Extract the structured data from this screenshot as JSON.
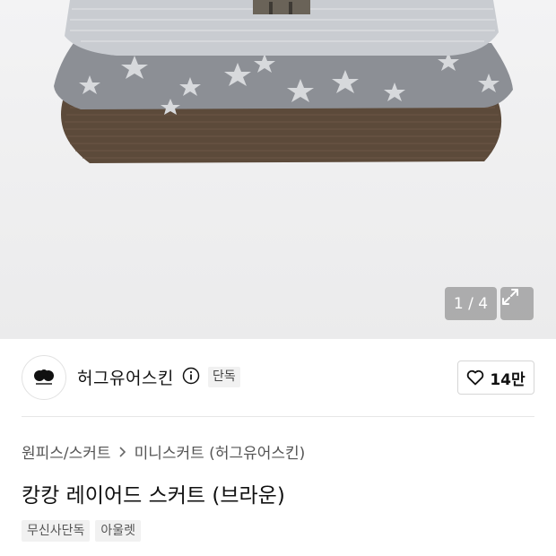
{
  "gallery": {
    "counter": "1 / 4",
    "expand_icon": "expand-icon"
  },
  "brand": {
    "name": "허그유어스킨",
    "info_icon": "info-icon",
    "exclusive_badge": "단독",
    "like_count": "14만",
    "heart_icon": "heart-icon"
  },
  "breadcrumb": {
    "category": "원피스/스커트",
    "subcategory": "미니스커트 (허그유어스킨)"
  },
  "product": {
    "title": "캉캉 레이어드 스커트 (브라운)",
    "tags": [
      "무신사단독",
      "아울렛"
    ]
  },
  "colors": {
    "skirt_top": "#c9ccd1",
    "skirt_mid": "#8c8f95",
    "skirt_bottom": "#5c4a3a",
    "badge_bg": "#f1f1f1"
  }
}
